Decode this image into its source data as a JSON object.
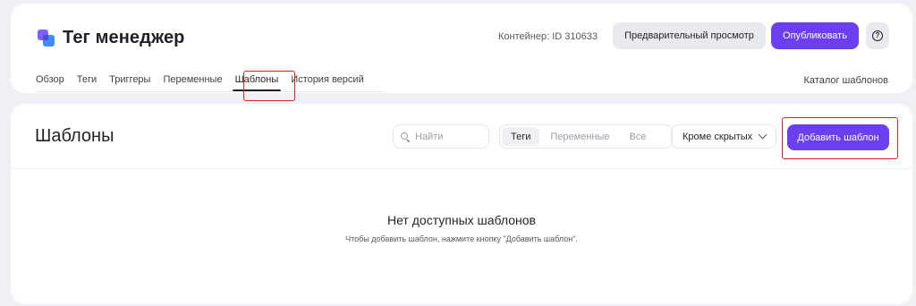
{
  "header": {
    "app_title": "Тег менеджер",
    "container_label": "Контейнер: ID 310633",
    "preview_label": "Предварительный просмотр",
    "publish_label": "Опубликовать",
    "help_glyph": "?",
    "tabs": [
      {
        "label": "Обзор"
      },
      {
        "label": "Теги"
      },
      {
        "label": "Триггеры"
      },
      {
        "label": "Переменные"
      },
      {
        "label": "Шаблоны",
        "active": true
      },
      {
        "label": "История версий"
      }
    ],
    "catalog_label": "Каталог шаблонов"
  },
  "main": {
    "title": "Шаблоны",
    "search": {
      "placeholder": "Найти",
      "value": ""
    },
    "segments": [
      {
        "label": "Теги",
        "active": true
      },
      {
        "label": "Переменные"
      },
      {
        "label": "Все"
      }
    ],
    "filter": {
      "selected": "Кроме скрытых"
    },
    "add_label": "Добавить шаблон",
    "empty": {
      "title": "Нет доступных шаблонов",
      "hint": "Чтобы добавить шаблон, нажмите кнопку \"Добавить шаблон\"."
    }
  },
  "colors": {
    "accent": "#6b3ff0",
    "highlight": "#e02020",
    "background": "#eef0f5"
  },
  "icons": {
    "logo": "tag-manager-logo-icon",
    "help": "help-circle-icon",
    "search": "search-icon",
    "filter": "chevron-down-icon"
  }
}
